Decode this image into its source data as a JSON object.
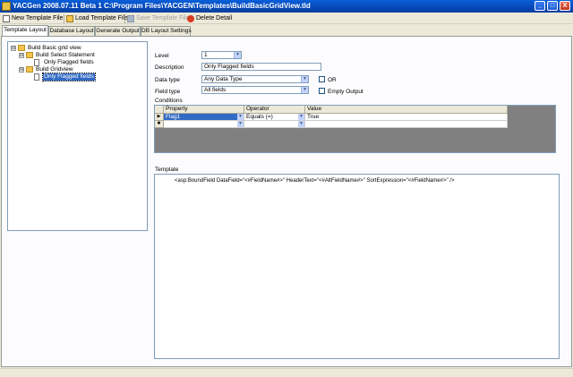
{
  "window": {
    "title": "YACGen 2008.07.11 Beta 1 C:\\Program Files\\YACGEN\\Templates\\BuildBasicGridView.tld",
    "minimize": "_",
    "maximize": "□",
    "close": "X"
  },
  "toolbar": {
    "new_label": "New Template File",
    "load_label": "Load Template File",
    "save_label": "Save Template File",
    "delete_label": "Delete Detail"
  },
  "tabs": [
    {
      "label": "Template Layout",
      "active": true
    },
    {
      "label": "Database Layout",
      "active": false
    },
    {
      "label": "Generate Output",
      "active": false
    },
    {
      "label": "DB Layout Settings",
      "active": false
    }
  ],
  "tree": {
    "nodes": [
      {
        "label": "Build Basic grid view",
        "expander": "⊟",
        "kind": "folder"
      },
      {
        "label": "Build Select Statement",
        "expander": "⊟",
        "kind": "folder"
      },
      {
        "label": "Only Flagged fields",
        "expander": "",
        "kind": "doc"
      },
      {
        "label": "Build Gridview",
        "expander": "⊟",
        "kind": "folder"
      },
      {
        "label": "Only Flagged fields",
        "expander": "",
        "kind": "doc",
        "selected": true
      }
    ]
  },
  "form": {
    "level_label": "Level",
    "level_value": "1",
    "description_label": "Description",
    "description_value": "Only Flagged fields",
    "datatype_label": "Data type",
    "datatype_value": "Any Data Type",
    "or_label": "OR",
    "fieldtype_label": "Field type",
    "fieldtype_value": "All fields",
    "empty_output_label": "Empty Output",
    "conditions_label": "Conditions"
  },
  "conditions": {
    "columns": [
      "Property",
      "Operator",
      "Value"
    ],
    "rows": [
      {
        "marker": "▶",
        "property": "Flag1",
        "operator": "Equals (=)",
        "value": "True"
      },
      {
        "marker": "✱",
        "property": "",
        "operator": "",
        "value": ""
      }
    ]
  },
  "template": {
    "label": "Template",
    "text": "<asp:BoundField DataField=\"<#FieldName#>\" HeaderText=\"<#AltFieldName#>\" SortExpression=\"<#FieldName#>\" />"
  }
}
